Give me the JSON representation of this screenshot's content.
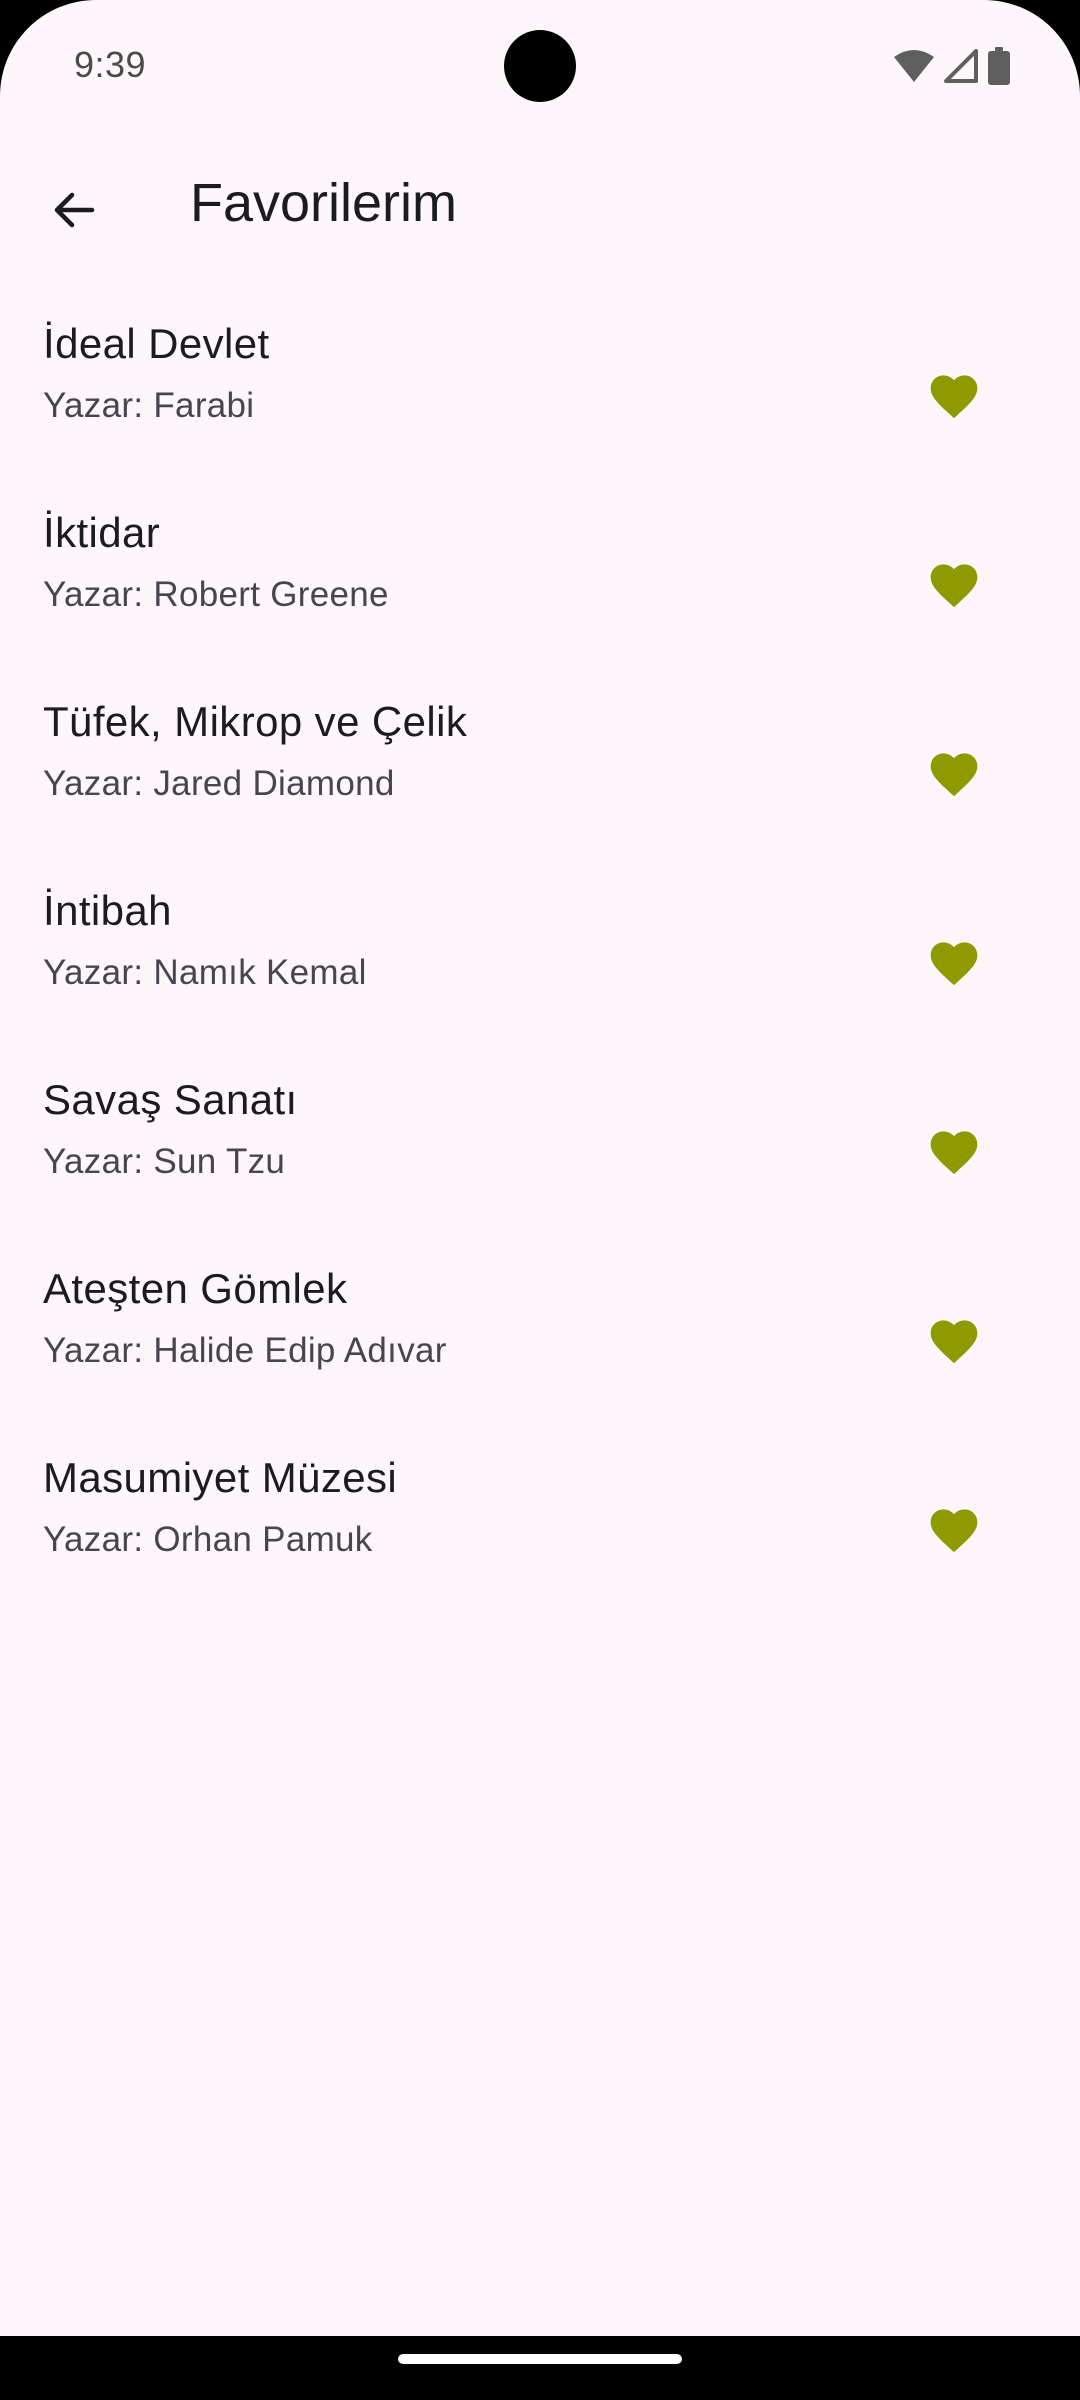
{
  "status_bar": {
    "time": "9:39",
    "icons": [
      "wifi-icon",
      "cellular-signal-icon",
      "battery-icon"
    ]
  },
  "app_bar": {
    "back_icon": "arrow-left-icon",
    "title": "Favorilerim"
  },
  "favorites": [
    {
      "title": "İdeal Devlet",
      "author": "Yazar: Farabi"
    },
    {
      "title": "İktidar",
      "author": "Yazar: Robert Greene"
    },
    {
      "title": "Tüfek, Mikrop ve Çelik",
      "author": "Yazar: Jared Diamond"
    },
    {
      "title": "İntibah",
      "author": "Yazar: Namık Kemal"
    },
    {
      "title": "Savaş Sanatı",
      "author": "Yazar: Sun Tzu"
    },
    {
      "title": "Ateşten Gömlek",
      "author": "Yazar: Halide Edip Adıvar"
    },
    {
      "title": "Masumiyet Müzesi",
      "author": "Yazar: Orhan Pamuk"
    }
  ],
  "colors": {
    "background": "#fdf7fc",
    "heart": "#8f9900",
    "title_text": "#1c1b1f",
    "subtitle_text": "#49454f"
  }
}
